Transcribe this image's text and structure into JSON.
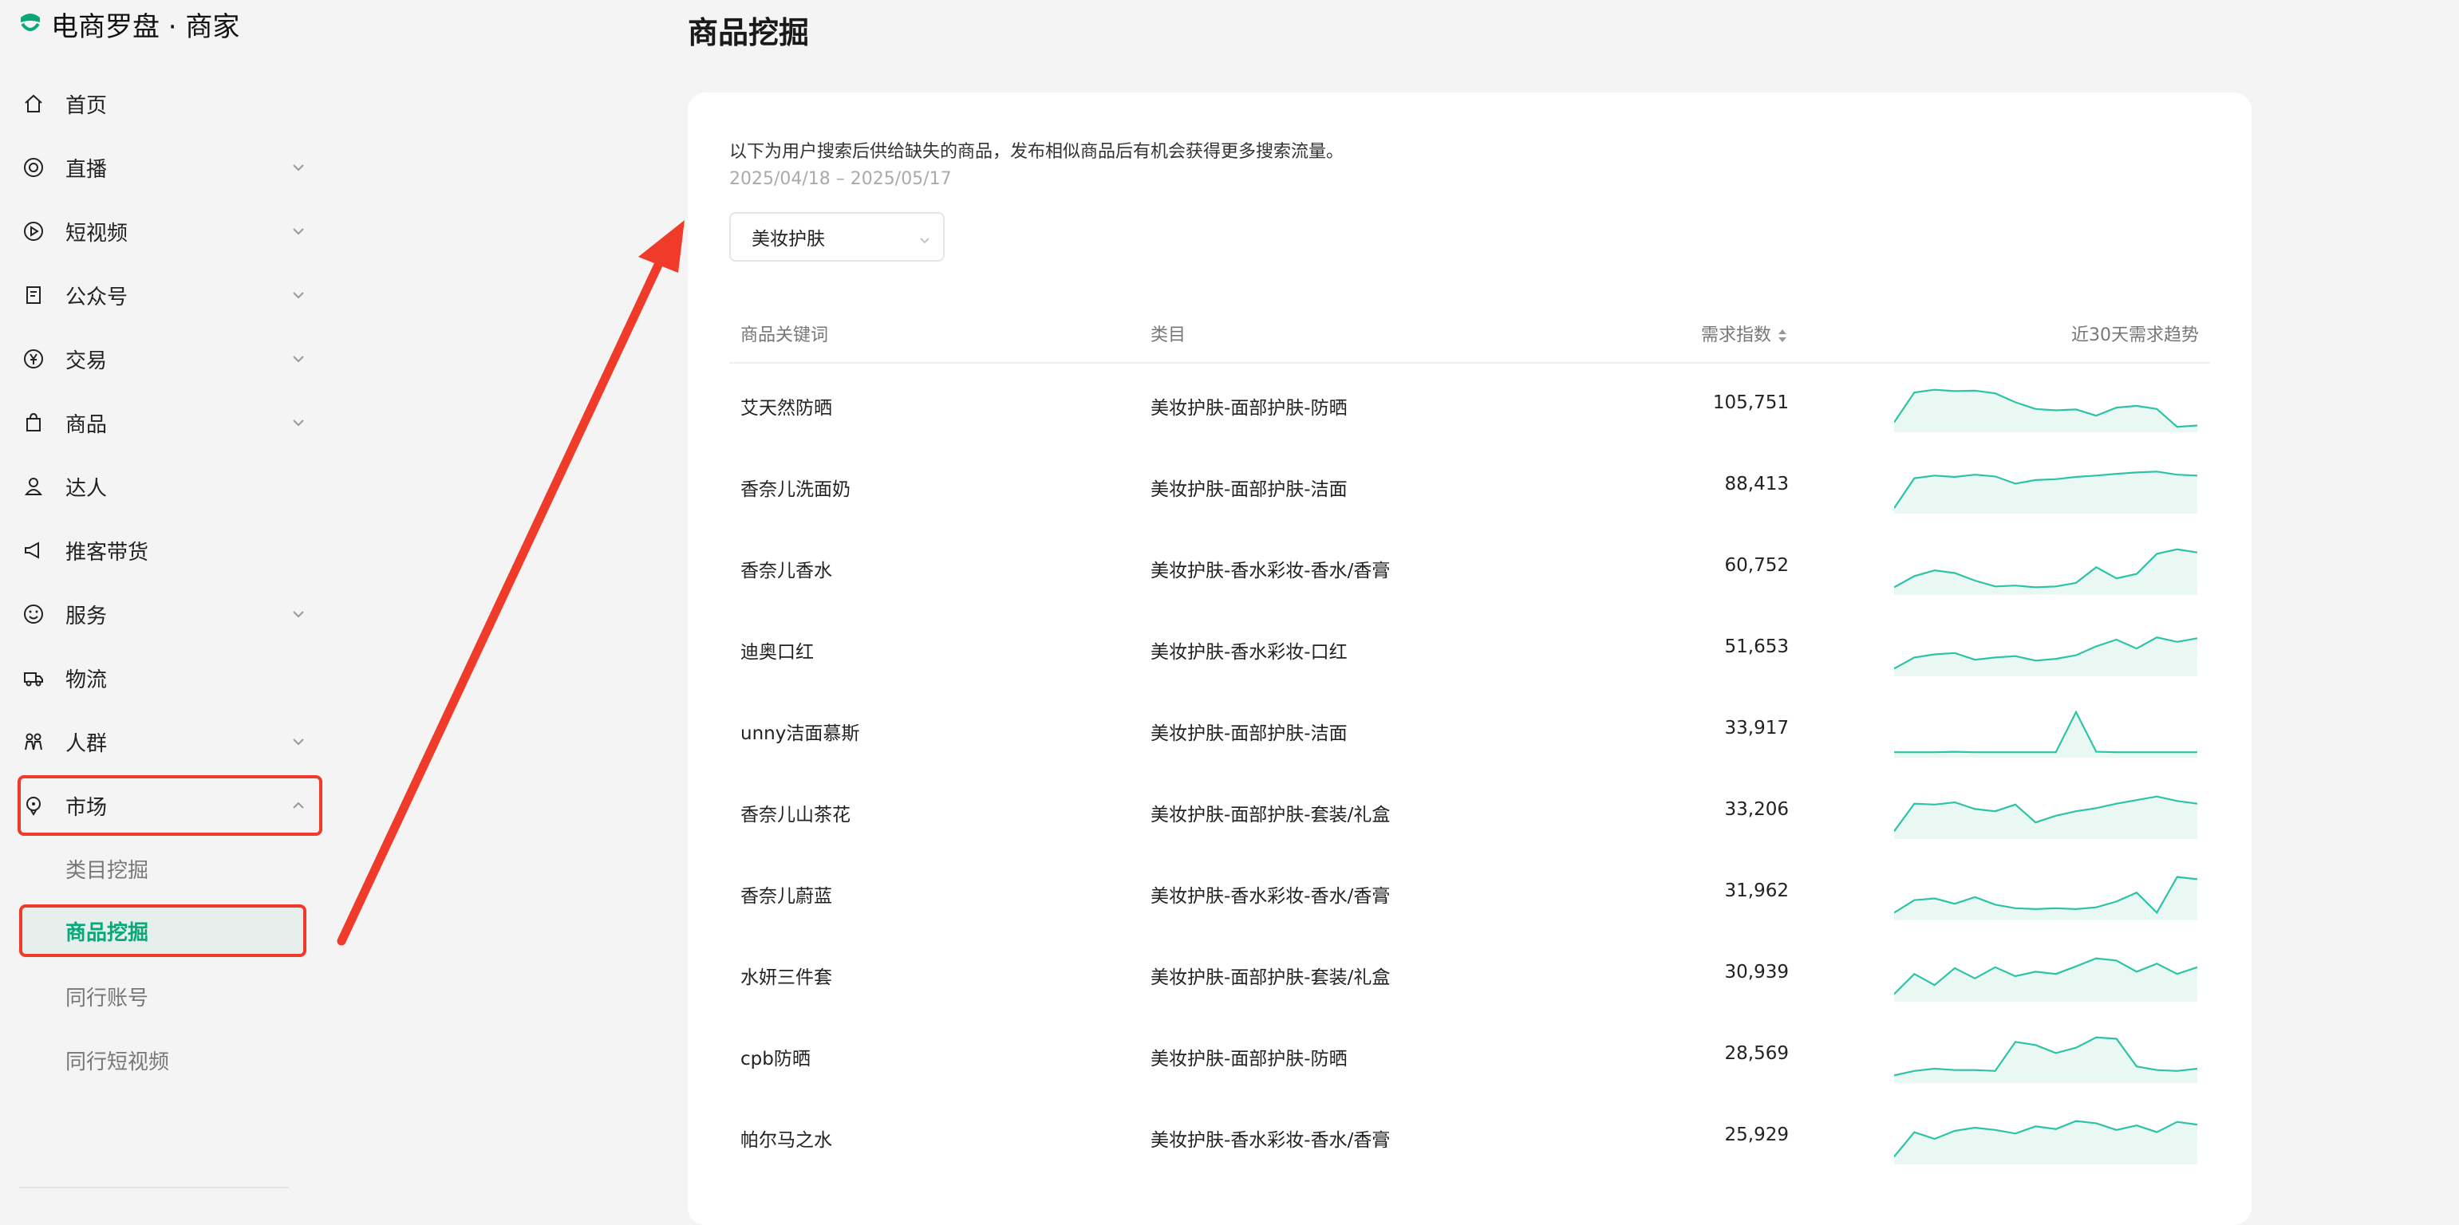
{
  "brand": {
    "title": "电商罗盘 · 商家"
  },
  "sidebar": {
    "items": [
      {
        "label": "首页",
        "icon": "home-icon",
        "expandable": false
      },
      {
        "label": "直播",
        "icon": "live-icon",
        "expandable": true
      },
      {
        "label": "短视频",
        "icon": "play-icon",
        "expandable": true
      },
      {
        "label": "公众号",
        "icon": "document-icon",
        "expandable": true
      },
      {
        "label": "交易",
        "icon": "yen-icon",
        "expandable": true
      },
      {
        "label": "商品",
        "icon": "bag-icon",
        "expandable": true
      },
      {
        "label": "达人",
        "icon": "user-icon",
        "expandable": false
      },
      {
        "label": "推客带货",
        "icon": "megaphone-icon",
        "expandable": false
      },
      {
        "label": "服务",
        "icon": "smile-icon",
        "expandable": true
      },
      {
        "label": "物流",
        "icon": "truck-icon",
        "expandable": false
      },
      {
        "label": "人群",
        "icon": "group-icon",
        "expandable": true
      },
      {
        "label": "市场",
        "icon": "bulb-icon",
        "expandable": true,
        "expanded": true
      }
    ],
    "sub_items": [
      {
        "label": "类目挖掘",
        "active": false
      },
      {
        "label": "商品挖掘",
        "active": true
      },
      {
        "label": "同行账号",
        "active": false
      },
      {
        "label": "同行短视频",
        "active": false
      }
    ]
  },
  "main": {
    "title": "商品挖掘",
    "description": "以下为用户搜索后供给缺失的商品，发布相似商品后有机会获得更多搜索流量。",
    "date_range": "2025/04/18 – 2025/05/17",
    "category_select": {
      "value": "美妆护肤"
    },
    "table": {
      "headers": {
        "keyword": "商品关键词",
        "category": "类目",
        "index": "需求指数",
        "trend": "近30天需求趋势"
      },
      "rows": [
        {
          "keyword": "艾天然防晒",
          "category": "美妆护肤-面部护肤-防晒",
          "index": "105,751",
          "trend": [
            0.15,
            0.82,
            0.88,
            0.85,
            0.86,
            0.8,
            0.6,
            0.45,
            0.42,
            0.44,
            0.3,
            0.48,
            0.52,
            0.45,
            0.05,
            0.08
          ]
        },
        {
          "keyword": "香奈儿洗面奶",
          "category": "美妆护肤-面部护肤-洁面",
          "index": "88,413",
          "trend": [
            0.05,
            0.72,
            0.78,
            0.75,
            0.8,
            0.76,
            0.6,
            0.68,
            0.7,
            0.75,
            0.78,
            0.82,
            0.85,
            0.87,
            0.8,
            0.78
          ]
        },
        {
          "keyword": "香奈儿香水",
          "category": "美妆护肤-香水彩妆-香水/香膏",
          "index": "60,752",
          "trend": [
            0.1,
            0.35,
            0.48,
            0.42,
            0.25,
            0.12,
            0.14,
            0.1,
            0.12,
            0.2,
            0.55,
            0.3,
            0.4,
            0.85,
            0.95,
            0.88
          ]
        },
        {
          "keyword": "迪奥口红",
          "category": "美妆护肤-香水彩妆-口红",
          "index": "51,653",
          "trend": [
            0.1,
            0.35,
            0.42,
            0.45,
            0.3,
            0.35,
            0.38,
            0.28,
            0.32,
            0.4,
            0.6,
            0.75,
            0.55,
            0.8,
            0.7,
            0.78
          ]
        },
        {
          "keyword": "unny洁面慕斯",
          "category": "美妆护肤-面部护肤-洁面",
          "index": "33,917",
          "trend": [
            0.05,
            0.05,
            0.05,
            0.06,
            0.05,
            0.05,
            0.05,
            0.05,
            0.05,
            0.95,
            0.06,
            0.05,
            0.05,
            0.05,
            0.05,
            0.05
          ]
        },
        {
          "keyword": "香奈儿山茶花",
          "category": "美妆护肤-面部护肤-套装/礼盒",
          "index": "33,206",
          "trend": [
            0.1,
            0.72,
            0.7,
            0.75,
            0.6,
            0.55,
            0.7,
            0.3,
            0.45,
            0.55,
            0.62,
            0.72,
            0.8,
            0.88,
            0.78,
            0.72
          ]
        },
        {
          "keyword": "香奈儿蔚蓝",
          "category": "美妆护肤-香水彩妆-香水/香膏",
          "index": "31,962",
          "trend": [
            0.1,
            0.38,
            0.42,
            0.3,
            0.45,
            0.28,
            0.2,
            0.18,
            0.2,
            0.18,
            0.22,
            0.35,
            0.55,
            0.1,
            0.9,
            0.85
          ]
        },
        {
          "keyword": "水妍三件套",
          "category": "美妆护肤-面部护肤-套装/礼盒",
          "index": "30,939",
          "trend": [
            0.1,
            0.55,
            0.3,
            0.68,
            0.45,
            0.7,
            0.5,
            0.6,
            0.55,
            0.72,
            0.9,
            0.85,
            0.6,
            0.78,
            0.55,
            0.7
          ]
        },
        {
          "keyword": "cpb防晒",
          "category": "美妆护肤-面部护肤-防晒",
          "index": "28,569",
          "trend": [
            0.1,
            0.2,
            0.25,
            0.22,
            0.22,
            0.2,
            0.85,
            0.78,
            0.6,
            0.72,
            0.95,
            0.92,
            0.3,
            0.22,
            0.2,
            0.25
          ]
        },
        {
          "keyword": "帕尔马之水",
          "category": "美妆护肤-香水彩妆-香水/香膏",
          "index": "25,929",
          "trend": [
            0.1,
            0.65,
            0.5,
            0.68,
            0.75,
            0.7,
            0.62,
            0.78,
            0.72,
            0.9,
            0.85,
            0.7,
            0.8,
            0.65,
            0.88,
            0.82
          ]
        }
      ]
    }
  },
  "colors": {
    "accent": "#0aa878",
    "trend_line": "#2cc3a6",
    "highlight": "#f03a2a"
  }
}
